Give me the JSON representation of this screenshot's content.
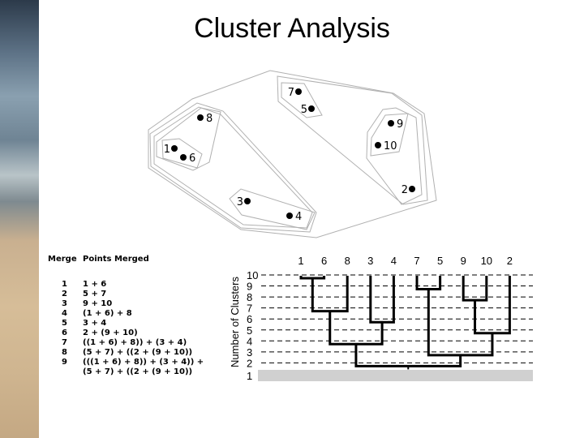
{
  "title": "Cluster Analysis",
  "scatter": {
    "points": [
      {
        "label": "7",
        "x": 368,
        "y": 113,
        "side": "left"
      },
      {
        "label": "5",
        "x": 384,
        "y": 134,
        "side": "left"
      },
      {
        "label": "8",
        "x": 247,
        "y": 145,
        "side": "right"
      },
      {
        "label": "9",
        "x": 482,
        "y": 152,
        "side": "right"
      },
      {
        "label": "10",
        "x": 466,
        "y": 179,
        "side": "right"
      },
      {
        "label": "1",
        "x": 215,
        "y": 183,
        "side": "left"
      },
      {
        "label": "6",
        "x": 226,
        "y": 194,
        "side": "right"
      },
      {
        "label": "2",
        "x": 508,
        "y": 233,
        "side": "left"
      },
      {
        "label": "3",
        "x": 305,
        "y": 248,
        "side": "left"
      },
      {
        "label": "4",
        "x": 357,
        "y": 266,
        "side": "right"
      }
    ]
  },
  "merge_table": {
    "headers": [
      "Merge",
      "Points Merged"
    ],
    "rows": [
      {
        "merge": "1",
        "points": "1 + 6"
      },
      {
        "merge": "2",
        "points": "5 + 7"
      },
      {
        "merge": "3",
        "points": "9 + 10"
      },
      {
        "merge": "4",
        "points": "(1 + 6) + 8"
      },
      {
        "merge": "5",
        "points": "3 + 4"
      },
      {
        "merge": "6",
        "points": "2 + (9 + 10)"
      },
      {
        "merge": "7",
        "points": "((1 + 6) + 8)) + (3 + 4)"
      },
      {
        "merge": "8",
        "points": "(5 + 7) + ((2 + (9 + 10))"
      },
      {
        "merge": "9",
        "points": "(((1 + 6) + 8)) + (3 + 4)) +"
      },
      {
        "merge": "",
        "points": "(5 + 7) + ((2 + (9 + 10))"
      }
    ]
  },
  "chart_data": {
    "type": "dendrogram",
    "ylabel": "Number of Clusters",
    "yticks": [
      "10",
      "9",
      "8",
      "7",
      "6",
      "5",
      "4",
      "3",
      "2",
      "1"
    ],
    "leaves": [
      "1",
      "6",
      "8",
      "3",
      "4",
      "7",
      "5",
      "9",
      "10",
      "2"
    ],
    "merges": [
      {
        "step": 1,
        "a": "1",
        "b": "6"
      },
      {
        "step": 2,
        "a": "7",
        "b": "5"
      },
      {
        "step": 3,
        "a": "9",
        "b": "10"
      },
      {
        "step": 4,
        "a": "m1",
        "b": "8"
      },
      {
        "step": 5,
        "a": "3",
        "b": "4"
      },
      {
        "step": 6,
        "a": "m3",
        "b": "2"
      },
      {
        "step": 7,
        "a": "m4",
        "b": "m5"
      },
      {
        "step": 8,
        "a": "m2",
        "b": "m6"
      },
      {
        "step": 9,
        "a": "m7",
        "b": "m8"
      }
    ],
    "grid": "dashed",
    "highlight_band_color": "#d0d0d0"
  }
}
